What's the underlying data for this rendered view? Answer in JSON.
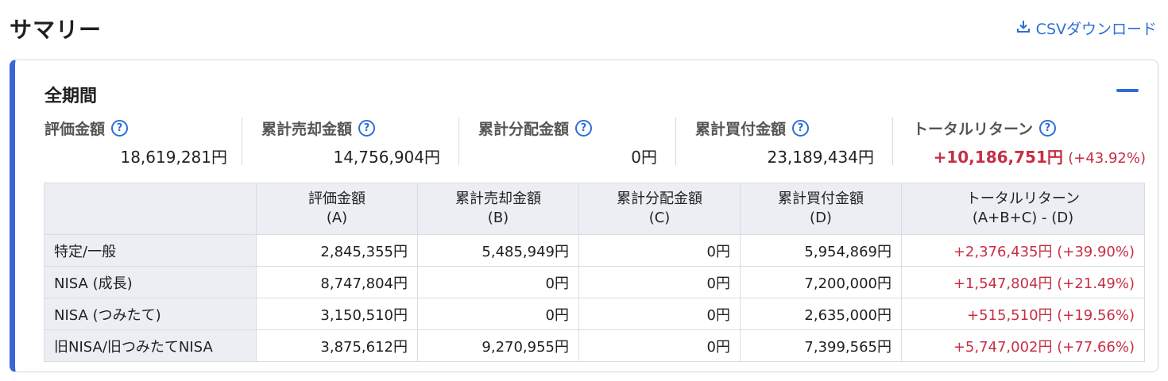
{
  "page_title": "サマリー",
  "csv_link": {
    "icon": "download-icon",
    "label": "CSVダウンロード"
  },
  "colors": {
    "accent": "#2c6ed8",
    "card_border": "#3b65d6",
    "negative_positive": "#c62f45"
  },
  "summary": {
    "title": "全期間",
    "metrics": [
      {
        "label": "評価金額",
        "value": "18,619,281円"
      },
      {
        "label": "累計売却金額",
        "value": "14,756,904円"
      },
      {
        "label": "累計分配金額",
        "value": "0円"
      },
      {
        "label": "累計買付金額",
        "value": "23,189,434円"
      },
      {
        "label": "トータルリターン",
        "value": "+10,186,751円",
        "pct": "(+43.92%)"
      }
    ]
  },
  "table": {
    "headers": [
      {
        "line1": "評価金額",
        "line2": "(A)"
      },
      {
        "line1": "累計売却金額",
        "line2": "(B)"
      },
      {
        "line1": "累計分配金額",
        "line2": "(C)"
      },
      {
        "line1": "累計買付金額",
        "line2": "(D)"
      },
      {
        "line1": "トータルリターン",
        "line2": "(A+B+C) - (D)"
      }
    ],
    "rows": [
      {
        "name": "特定/一般",
        "a": "2,845,355円",
        "b": "5,485,949円",
        "c": "0円",
        "d": "5,954,869円",
        "total": "+2,376,435円 (+39.90%)"
      },
      {
        "name": "NISA (成長)",
        "a": "8,747,804円",
        "b": "0円",
        "c": "0円",
        "d": "7,200,000円",
        "total": "+1,547,804円 (+21.49%)"
      },
      {
        "name": "NISA (つみたて)",
        "a": "3,150,510円",
        "b": "0円",
        "c": "0円",
        "d": "2,635,000円",
        "total": "+515,510円 (+19.56%)"
      },
      {
        "name": "旧NISA/旧つみたてNISA",
        "a": "3,875,612円",
        "b": "9,270,955円",
        "c": "0円",
        "d": "7,399,565円",
        "total": "+5,747,002円 (+77.66%)"
      }
    ]
  }
}
